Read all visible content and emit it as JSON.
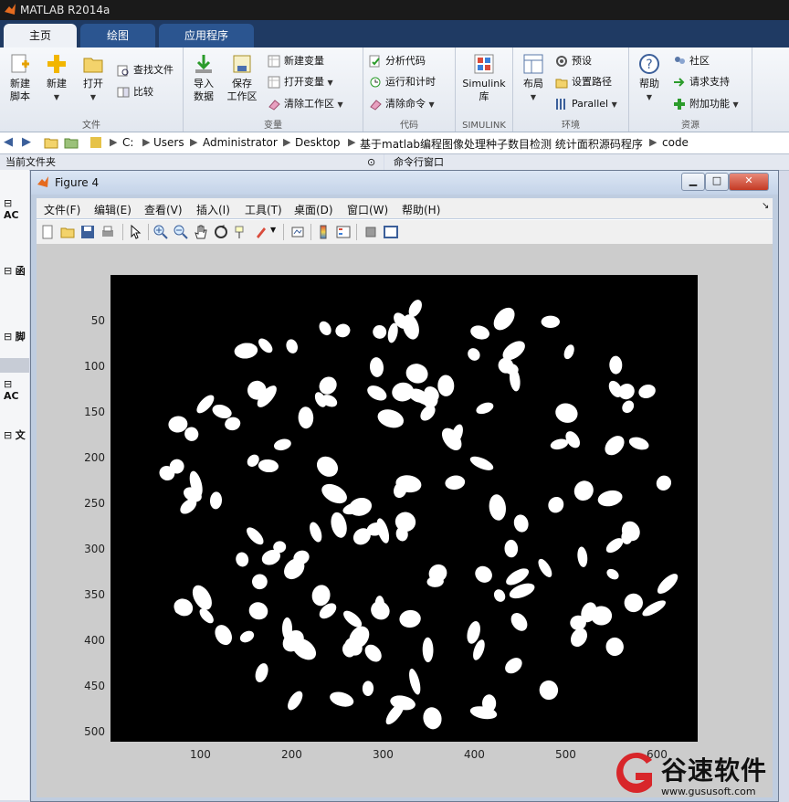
{
  "app": {
    "title": "MATLAB R2014a"
  },
  "tabs": [
    {
      "label": "主页",
      "active": true
    },
    {
      "label": "绘图",
      "active": false
    },
    {
      "label": "应用程序",
      "active": false
    }
  ],
  "ribbon": {
    "file_group": {
      "label": "文件",
      "new_script": "新建\n脚本",
      "new": "新建",
      "open": "打开",
      "find_files": "查找文件",
      "compare": "比较"
    },
    "variable_group": {
      "label": "变量",
      "import": "导入\n数据",
      "save_ws": "保存\n工作区",
      "new_var": "新建变量",
      "open_var": "打开变量",
      "clear_ws": "清除工作区"
    },
    "code_group": {
      "label": "代码",
      "analyze": "分析代码",
      "run_time": "运行和计时",
      "clear_cmd": "清除命令"
    },
    "simulink_group": {
      "label": "SIMULINK",
      "lib": "Simulink\n库"
    },
    "env_group": {
      "label": "环境",
      "layout": "布局",
      "prefs": "预设",
      "set_path": "设置路径",
      "parallel": "Parallel"
    },
    "resources_group": {
      "label": "资源",
      "help": "帮助",
      "community": "社区",
      "support": "请求支持",
      "addons": "附加功能"
    }
  },
  "address": {
    "crumbs": [
      "C:",
      "Users",
      "Administrator",
      "Desktop",
      "基于matlab编程图像处理种子数目检测 统计面积源码程序",
      "code"
    ]
  },
  "panels": {
    "current_folder": "当前文件夹",
    "command_window": "命令行窗口"
  },
  "left_tree": [
    "AC",
    "函",
    "脚",
    "AC",
    "文"
  ],
  "figure": {
    "title": "Figure 4",
    "menu": [
      "文件(F)",
      "编辑(E)",
      "查看(V)",
      "插入(I)",
      "工具(T)",
      "桌面(D)",
      "窗口(W)",
      "帮助(H)"
    ],
    "x_ticks": [
      "100",
      "200",
      "300",
      "400",
      "500",
      "600"
    ],
    "y_ticks": [
      "50",
      "100",
      "150",
      "200",
      "250",
      "300",
      "350",
      "400",
      "450",
      "500"
    ]
  },
  "watermark": {
    "brand": "谷速软件",
    "url": "www.gususoft.com"
  },
  "colors": {
    "accent": "#1f3a63",
    "tab_blue": "#2b5590",
    "plot_bg": "#000000",
    "blob": "#ffffff"
  }
}
